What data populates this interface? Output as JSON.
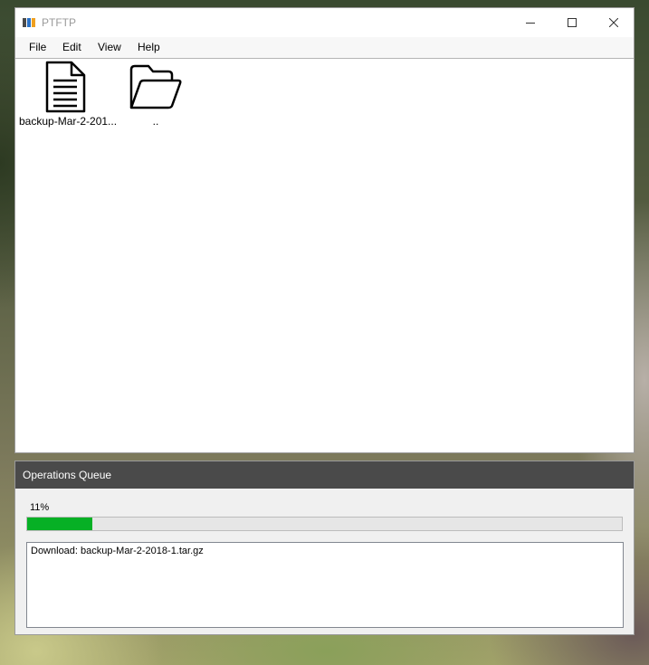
{
  "window": {
    "title": "PTFTP",
    "logo_colors": [
      "#4a4a4a",
      "#2a72c8",
      "#f0a020"
    ]
  },
  "menu": {
    "items": [
      "File",
      "Edit",
      "View",
      "Help"
    ]
  },
  "files": [
    {
      "name": "backup-Mar-2-201...",
      "icon": "document-icon"
    },
    {
      "name": "..",
      "icon": "folder-icon"
    }
  ],
  "queue": {
    "title": "Operations Queue",
    "progress_text": "11%",
    "progress_value": 0.11,
    "progress_color": "#06b025",
    "log": [
      "Download: backup-Mar-2-2018-1.tar.gz"
    ]
  }
}
